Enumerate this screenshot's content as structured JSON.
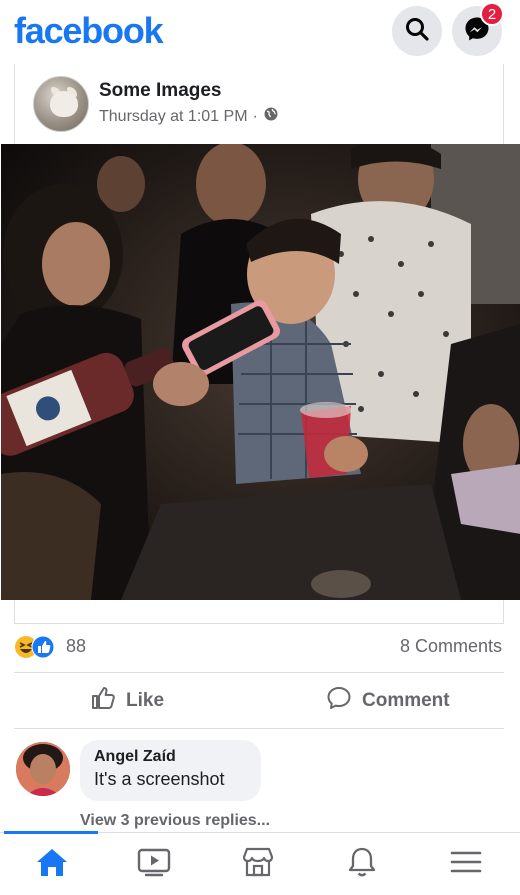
{
  "app": {
    "logo_text": "facebook",
    "brand_color": "#1877f2"
  },
  "header": {
    "search_icon": "search-icon",
    "messenger_icon": "messenger-icon",
    "messenger_badge": "2"
  },
  "post": {
    "page_name": "Some Images",
    "timestamp": "Thursday at 1:01 PM",
    "separator": "·",
    "audience_icon": "globe-icon",
    "reaction_icons": [
      "haha-icon",
      "like-icon"
    ],
    "reaction_count": "88",
    "comments_count": "8 Comments",
    "like_label": "Like",
    "comment_label": "Comment"
  },
  "comment": {
    "author": "Angel Zaíd",
    "text": "It's a screenshot",
    "view_replies": "View 3 previous replies..."
  },
  "bottom_nav": {
    "items": [
      "home-icon",
      "watch-icon",
      "marketplace-icon",
      "notifications-icon",
      "menu-icon"
    ],
    "active_color": "#1877f2",
    "inactive_color": "#65676b"
  }
}
